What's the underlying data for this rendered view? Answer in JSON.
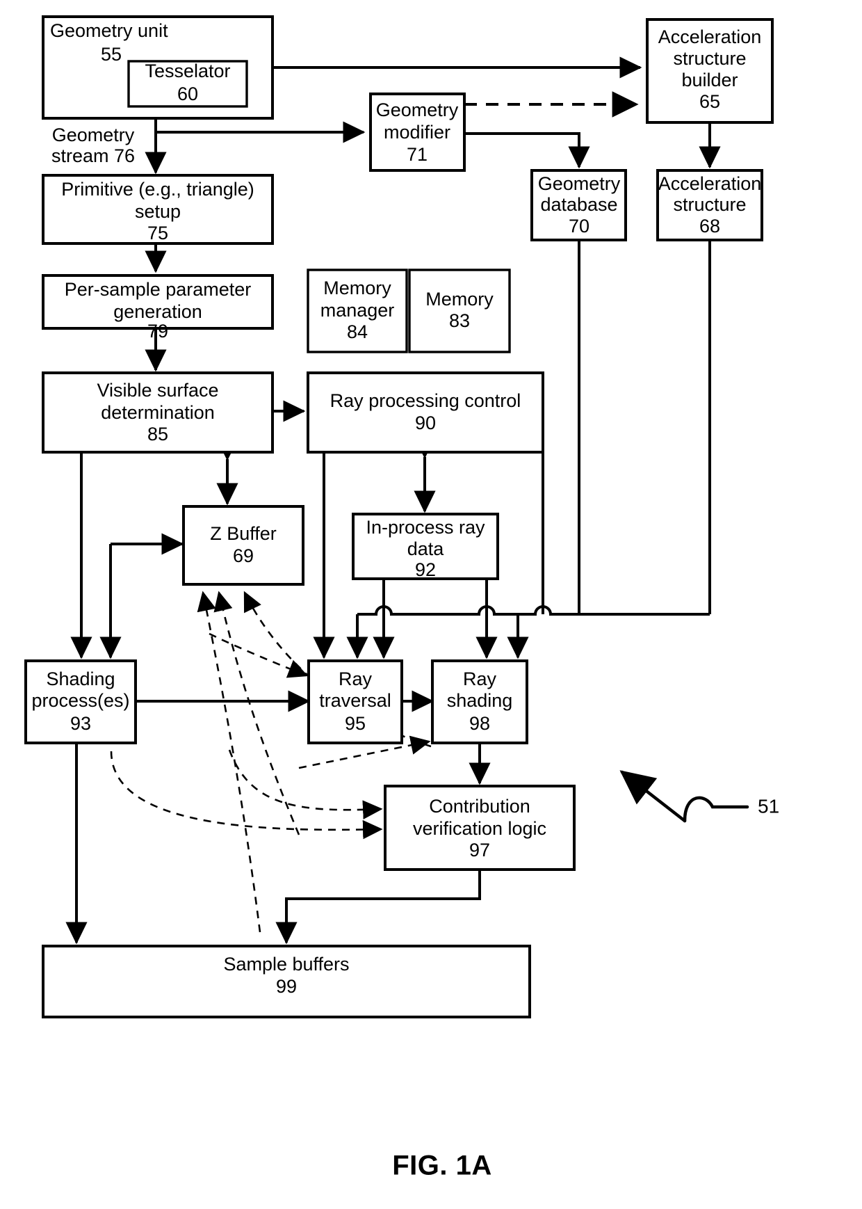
{
  "figure": {
    "caption": "FIG. 1A",
    "system_ref": "51"
  },
  "blocks": {
    "geometry_unit": {
      "lines": [
        "Geometry  unit"
      ],
      "ref": "55"
    },
    "tesselator": {
      "lines": [
        "Tesselator"
      ],
      "ref": "60"
    },
    "acceleration_builder": {
      "lines": [
        "Acceleration",
        "structure",
        "builder"
      ],
      "ref": "65"
    },
    "geometry_modifier": {
      "lines": [
        "Geometry",
        "modifier"
      ],
      "ref": "71"
    },
    "geometry_database": {
      "lines": [
        "Geometry",
        "database"
      ],
      "ref": "70"
    },
    "acceleration_structure": {
      "lines": [
        "Acceleration",
        "structure"
      ],
      "ref": "68"
    },
    "primitive_setup": {
      "lines": [
        "Primitive (e.g., triangle)",
        "setup"
      ],
      "ref": "75"
    },
    "per_sample_param": {
      "lines": [
        "Per-sample parameter",
        "generation"
      ],
      "ref": "79"
    },
    "memory_manager": {
      "lines": [
        "Memory",
        "manager"
      ],
      "ref": "84"
    },
    "memory": {
      "lines": [
        "Memory"
      ],
      "ref": "83"
    },
    "visible_surface": {
      "lines": [
        "Visible surface",
        "determination"
      ],
      "ref": "85"
    },
    "ray_processing_control": {
      "lines": [
        "Ray processing control"
      ],
      "ref": "90"
    },
    "z_buffer": {
      "lines": [
        "Z Buffer"
      ],
      "ref": "69"
    },
    "in_process_ray_data": {
      "lines": [
        "In-process ray",
        "data"
      ],
      "ref": "92"
    },
    "shading_processes": {
      "lines": [
        "Shading",
        "process(es)"
      ],
      "ref": "93"
    },
    "ray_traversal": {
      "lines": [
        "Ray",
        "traversal"
      ],
      "ref": "95"
    },
    "ray_shading": {
      "lines": [
        "Ray",
        "shading"
      ],
      "ref": "98"
    },
    "contribution_verification": {
      "lines": [
        "Contribution",
        "verification logic"
      ],
      "ref": "97"
    },
    "sample_buffers": {
      "lines": [
        "Sample buffers"
      ],
      "ref": "99"
    }
  },
  "annotations": {
    "geometry_stream_line1": "Geometry",
    "geometry_stream_line2": "stream 76"
  },
  "colors": {
    "stroke": "#000000",
    "fill": "#ffffff",
    "background": "#ffffff"
  }
}
